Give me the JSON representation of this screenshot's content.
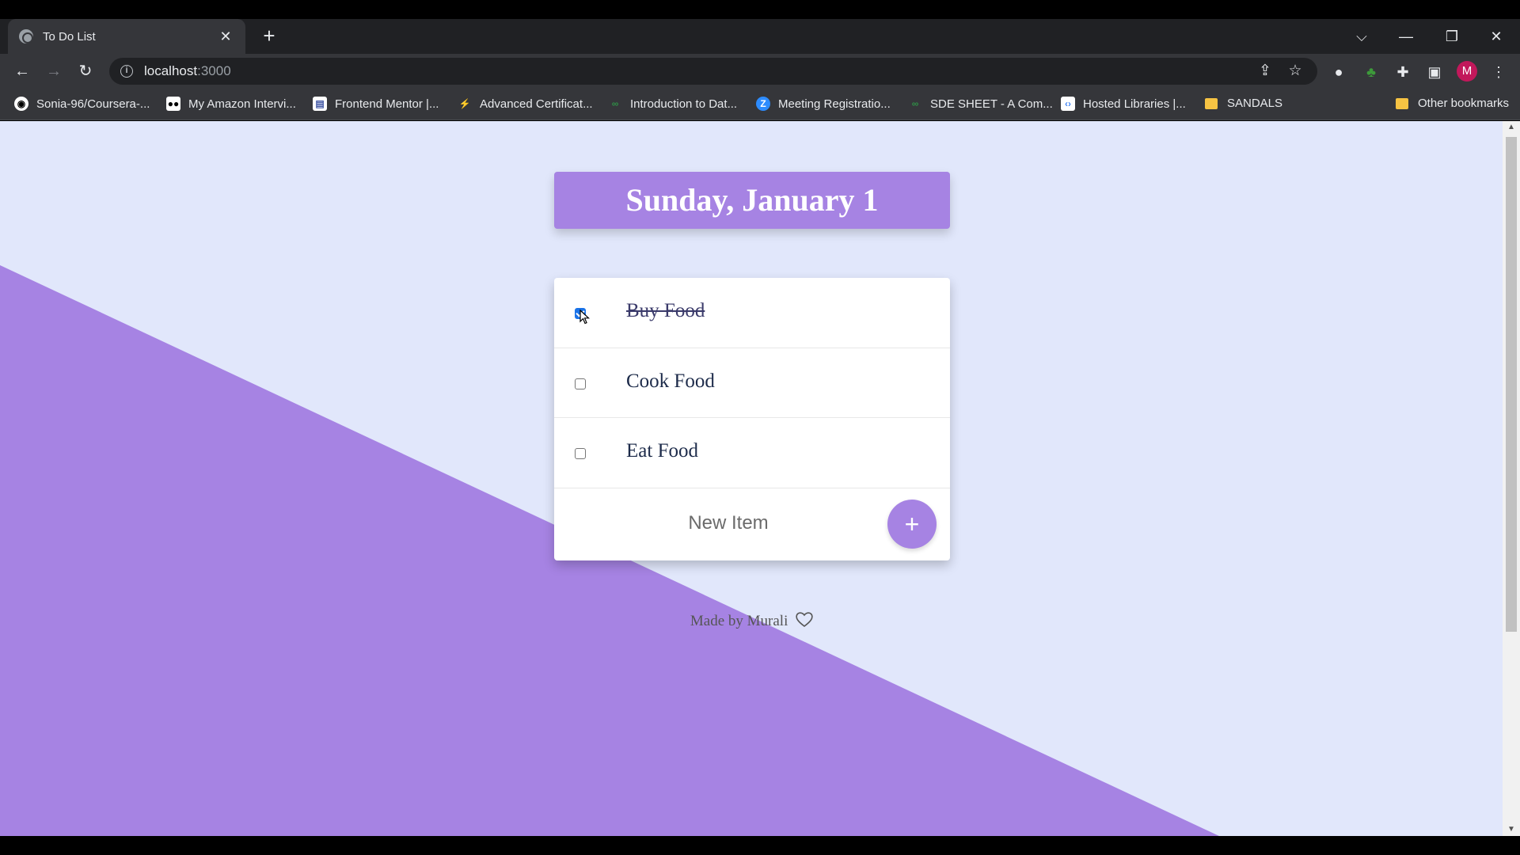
{
  "browser": {
    "tab_title": "To Do List",
    "tab_close": "✕",
    "new_tab": "+",
    "url_host": "localhost",
    "url_port": ":3000",
    "avatar_letter": "M",
    "window_controls": {
      "dropdown": "⌵",
      "minimize": "—",
      "restore": "❐",
      "close": "✕"
    }
  },
  "bookmarks": [
    {
      "label": "Sonia-96/Coursera-...",
      "icon": "github-icon"
    },
    {
      "label": "My Amazon Intervi...",
      "icon": "medium-icon"
    },
    {
      "label": "Frontend Mentor |...",
      "icon": "frontend-mentor-icon"
    },
    {
      "label": "Advanced Certificat...",
      "icon": "certificate-icon"
    },
    {
      "label": "Introduction to Dat...",
      "icon": "gfg-icon"
    },
    {
      "label": "Meeting Registratio...",
      "icon": "zoom-icon"
    },
    {
      "label": "SDE SHEET - A Com...",
      "icon": "gfg-icon"
    },
    {
      "label": "Hosted Libraries |...",
      "icon": "google-developers-icon"
    },
    {
      "label": "SANDALS",
      "icon": "folder-icon"
    }
  ],
  "other_bookmarks": "Other bookmarks",
  "page": {
    "heading": "Sunday, January 1",
    "items": [
      {
        "text": "Buy Food",
        "checked": true
      },
      {
        "text": "Cook Food",
        "checked": false
      },
      {
        "text": "Eat Food",
        "checked": false
      }
    ],
    "new_item_placeholder": "New Item",
    "add_button": "+",
    "footer": "Made by Murali"
  },
  "colors": {
    "accent": "#a683e3",
    "background": "#e1e7fb",
    "card": "#ffffff"
  }
}
